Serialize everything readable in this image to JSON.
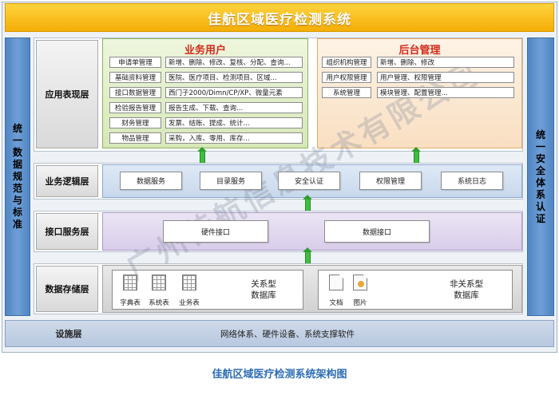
{
  "title": "佳航区域医疗检测系统",
  "left_sidebar": [
    "统",
    "一",
    "数",
    "据",
    "规",
    "范",
    "与",
    "标",
    "准"
  ],
  "right_sidebar": [
    "统",
    "一",
    "安",
    "全",
    "体",
    "系",
    "认",
    "证"
  ],
  "layers": {
    "app": "应用表现层",
    "logic": "业务逻辑层",
    "interface": "接口服务层",
    "storage": "数据存储层",
    "infra": "设施层"
  },
  "business_users": {
    "heading": "业务用户",
    "rows": [
      {
        "name": "申请单管理",
        "desc": "新增、删除、修改、复核、分配、查询..."
      },
      {
        "name": "基础资料管理",
        "desc": "医院、医疗项目、检测项目、区域..."
      },
      {
        "name": "接口数据管理",
        "desc": "西门子2000/Dimn/CP/XP、微量元素"
      },
      {
        "name": "检验报告管理",
        "desc": "报告生成、下载、查询..."
      },
      {
        "name": "财务管理",
        "desc": "发票、结账、提成、统计..."
      },
      {
        "name": "物品管理",
        "desc": "采购，入库、零用、库存..."
      }
    ]
  },
  "admin": {
    "heading": "后台管理",
    "rows": [
      {
        "name": "组织机构管理",
        "desc": "新增、删除、修改"
      },
      {
        "name": "用户权限管理",
        "desc": "用户管理、权限管理"
      },
      {
        "name": "系统管理",
        "desc": "模块管理、配置管理..."
      }
    ]
  },
  "logic_items": [
    "数据服务",
    "目录服务",
    "安全认证",
    "权限管理",
    "系统日志"
  ],
  "interface_items": [
    "硬件接口",
    "数据接口"
  ],
  "storage": {
    "relational": {
      "icons": [
        "字典表",
        "系统表",
        "业务表"
      ],
      "label_line1": "关系型",
      "label_line2": "数据库"
    },
    "nonrelational": {
      "icons": [
        "文档",
        "图片"
      ],
      "label_line1": "非关系型",
      "label_line2": "数据库"
    }
  },
  "infra_text": "网络体系、硬件设备、系统支撑软件",
  "caption": "佳航区域医疗检测系统架构图",
  "watermark": "广州佳航信息技术有限公司"
}
